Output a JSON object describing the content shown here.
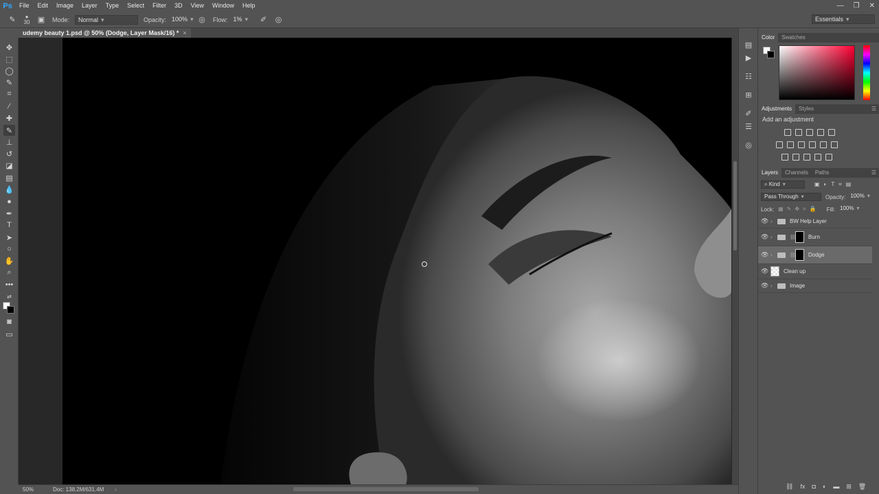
{
  "app": {
    "logo": "Ps",
    "menu": [
      "File",
      "Edit",
      "Image",
      "Layer",
      "Type",
      "Select",
      "Filter",
      "3D",
      "View",
      "Window",
      "Help"
    ]
  },
  "options": {
    "brush_size": "30",
    "mode_label": "Mode:",
    "mode_value": "Normal",
    "opacity_label": "Opacity:",
    "opacity_value": "100%",
    "flow_label": "Flow:",
    "flow_value": "1%",
    "workspace": "Essentials"
  },
  "document": {
    "tab_title": "udemy beauty 1.psd @ 50% (Dodge, Layer Mask/16) *",
    "close": "×"
  },
  "status": {
    "zoom": "50%",
    "doc_info": "Doc: 138.2M/631.4M"
  },
  "panels": {
    "color_tabs": [
      "Color",
      "Swatches"
    ],
    "adjust_tabs": [
      "Adjustments",
      "Styles"
    ],
    "adjust_title": "Add an adjustment",
    "layer_tabs": [
      "Layers",
      "Channels",
      "Paths"
    ],
    "kind_label": "Kind",
    "blend_mode": "Pass Through",
    "opacity_label": "Opacity:",
    "opacity_value": "100%",
    "lock_label": "Lock:",
    "fill_label": "Fill:",
    "fill_value": "100%"
  },
  "layers": [
    {
      "name": "BW Help Layer",
      "type": "group",
      "mask": false
    },
    {
      "name": "Burn",
      "type": "group",
      "mask": true
    },
    {
      "name": "Dodge",
      "type": "group",
      "mask": true,
      "selected": true
    },
    {
      "name": "Clean up",
      "type": "pixel",
      "mask": false
    },
    {
      "name": "Image",
      "type": "group",
      "mask": false
    }
  ],
  "colors": {
    "foreground": "#ffffff",
    "background": "#000000",
    "accent": "#31a8ff"
  }
}
